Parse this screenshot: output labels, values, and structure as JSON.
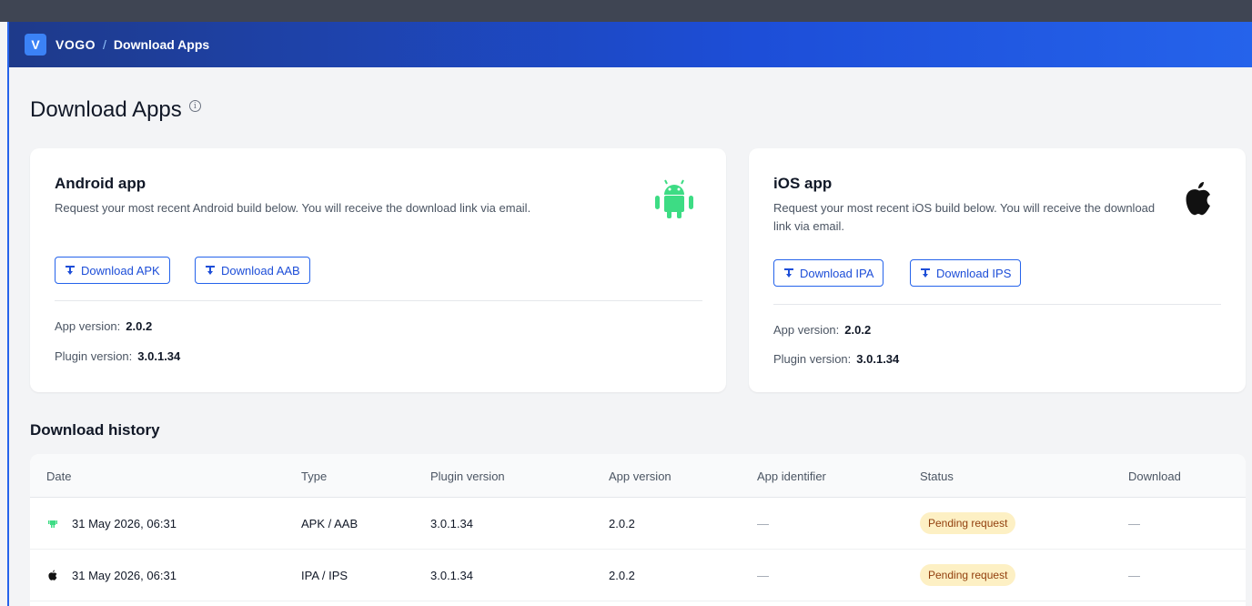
{
  "header": {
    "logo_letter": "V",
    "brand": "VOGO",
    "separator": "/",
    "breadcrumb": "Download Apps"
  },
  "page": {
    "title": "Download Apps",
    "info_glyph": "i"
  },
  "android": {
    "title": "Android app",
    "description": "Request your most recent Android build below. You will receive the download link via email.",
    "icon": "android-icon",
    "buttons": [
      "Download APK",
      "Download AAB"
    ],
    "app_version_label": "App version:",
    "app_version": "2.0.2",
    "plugin_version_label": "Plugin version:",
    "plugin_version": "3.0.1.34"
  },
  "ios": {
    "title": "iOS app",
    "description": "Request your most recent iOS build below. You will receive the download link via email.",
    "icon": "apple-icon",
    "buttons": [
      "Download IPA",
      "Download IPS"
    ],
    "app_version_label": "App version:",
    "app_version": "2.0.2",
    "plugin_version_label": "Plugin version:",
    "plugin_version": "3.0.1.34"
  },
  "history": {
    "title": "Download history",
    "columns": [
      "Date",
      "Type",
      "Plugin version",
      "App version",
      "App identifier",
      "Status",
      "Download"
    ],
    "rows": [
      {
        "platform_icon": "android-icon",
        "date": "31 May 2026, 06:31",
        "type": "APK / AAB",
        "plugin_version": "3.0.1.34",
        "app_version": "2.0.2",
        "app_identifier": "—",
        "status": "Pending request",
        "download": "—"
      },
      {
        "platform_icon": "apple-icon",
        "date": "31 May 2026, 06:31",
        "type": "IPA / IPS",
        "plugin_version": "3.0.1.34",
        "app_version": "2.0.2",
        "app_identifier": "—",
        "status": "Pending request",
        "download": "—"
      }
    ]
  },
  "colors": {
    "header_start": "#1e3a8a",
    "header_end": "#2563eb",
    "accent": "#2563eb",
    "android_green": "#3ddc84",
    "badge_bg": "#fdf0c4",
    "badge_text": "#92400e"
  }
}
